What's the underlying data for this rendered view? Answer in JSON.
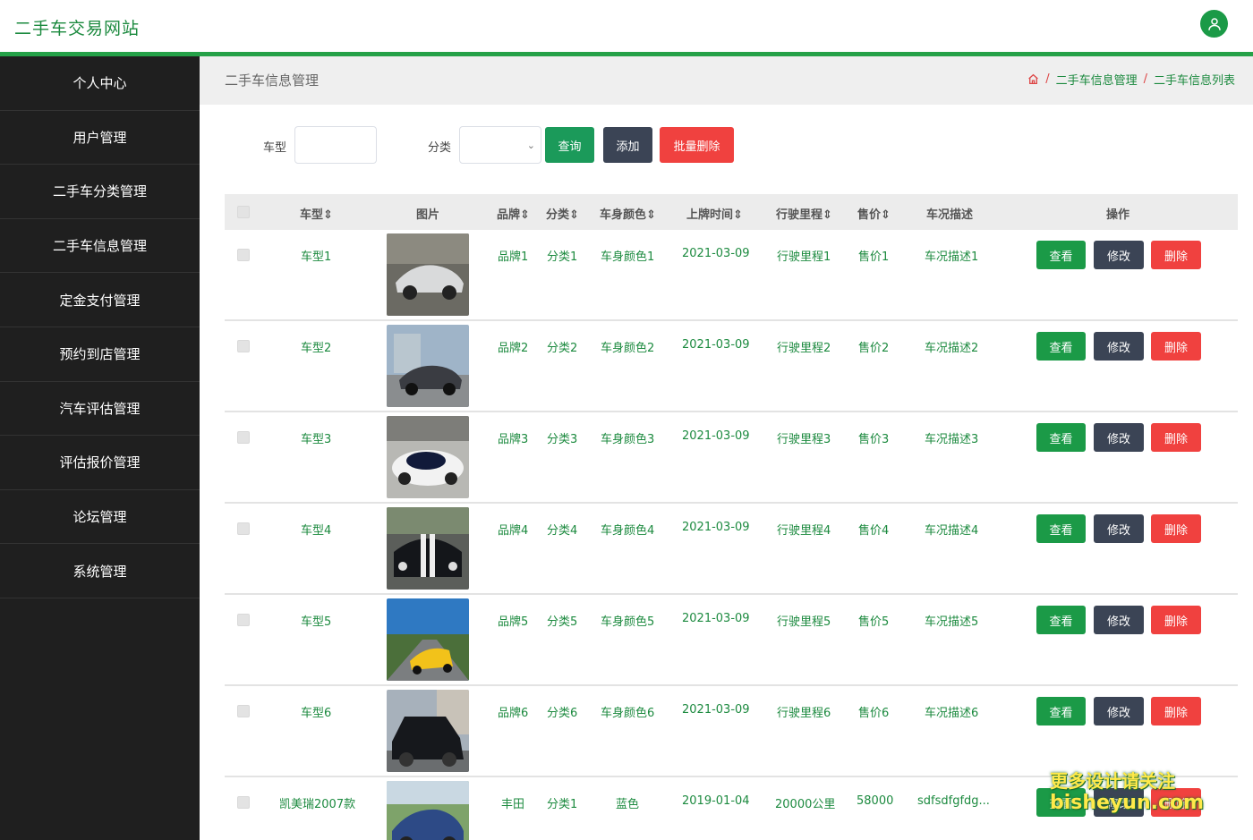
{
  "header": {
    "site_title": "二手车交易网站",
    "avatar_icon": "user-icon"
  },
  "sidebar": {
    "items": [
      {
        "label": "个人中心"
      },
      {
        "label": "用户管理"
      },
      {
        "label": "二手车分类管理"
      },
      {
        "label": "二手车信息管理"
      },
      {
        "label": "定金支付管理"
      },
      {
        "label": "预约到店管理"
      },
      {
        "label": "汽车评估管理"
      },
      {
        "label": "评估报价管理"
      },
      {
        "label": "论坛管理"
      },
      {
        "label": "系统管理"
      }
    ]
  },
  "content": {
    "page_title": "二手车信息管理",
    "breadcrumb": {
      "home_icon": "home-icon",
      "sep": "/",
      "level1": "二手车信息管理",
      "level2": "二手车信息列表"
    }
  },
  "search": {
    "model_label": "车型",
    "model_value": "",
    "category_label": "分类",
    "category_value": "",
    "query_button": "查询",
    "add_button": "添加",
    "batch_delete_button": "批量删除"
  },
  "table": {
    "headers": {
      "model": "车型",
      "image": "图片",
      "brand": "品牌",
      "category": "分类",
      "color": "车身颜色",
      "plate_date": "上牌时间",
      "mileage": "行驶里程",
      "price": "售价",
      "description": "车况描述",
      "actions": "操作"
    },
    "sort_icon": "sort-icon",
    "action_labels": {
      "view": "查看",
      "edit": "修改",
      "delete": "删除"
    },
    "rows": [
      {
        "model": "车型1",
        "brand": "品牌1",
        "category": "分类1",
        "color": "车身颜色1",
        "plate_date": "2021-03-09",
        "mileage": "行驶里程1",
        "price": "售价1",
        "description": "车况描述1"
      },
      {
        "model": "车型2",
        "brand": "品牌2",
        "category": "分类2",
        "color": "车身颜色2",
        "plate_date": "2021-03-09",
        "mileage": "行驶里程2",
        "price": "售价2",
        "description": "车况描述2"
      },
      {
        "model": "车型3",
        "brand": "品牌3",
        "category": "分类3",
        "color": "车身颜色3",
        "plate_date": "2021-03-09",
        "mileage": "行驶里程3",
        "price": "售价3",
        "description": "车况描述3"
      },
      {
        "model": "车型4",
        "brand": "品牌4",
        "category": "分类4",
        "color": "车身颜色4",
        "plate_date": "2021-03-09",
        "mileage": "行驶里程4",
        "price": "售价4",
        "description": "车况描述4"
      },
      {
        "model": "车型5",
        "brand": "品牌5",
        "category": "分类5",
        "color": "车身颜色5",
        "plate_date": "2021-03-09",
        "mileage": "行驶里程5",
        "price": "售价5",
        "description": "车况描述5"
      },
      {
        "model": "车型6",
        "brand": "品牌6",
        "category": "分类6",
        "color": "车身颜色6",
        "plate_date": "2021-03-09",
        "mileage": "行驶里程6",
        "price": "售价6",
        "description": "车况描述6"
      },
      {
        "model": "凯美瑞2007款",
        "brand": "丰田",
        "category": "分类1",
        "color": "蓝色",
        "plate_date": "2019-01-04",
        "mileage": "20000公里",
        "price": "58000",
        "description": "sdfsdfgfdg..."
      }
    ]
  },
  "watermark": {
    "line1": "更多设计请关注",
    "line2": "bisheyun.com"
  },
  "colors": {
    "brand_green": "#25a148",
    "text_green": "#1c8a3f",
    "sidebar_bg": "#1f1f1f",
    "danger": "#f0413f",
    "dark_button": "#3b4455"
  }
}
